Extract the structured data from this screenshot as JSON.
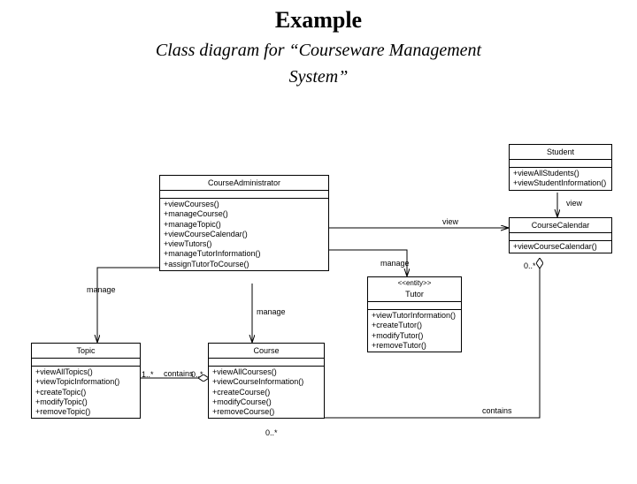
{
  "title": "Example",
  "subtitle_line1": "Class diagram for “Courseware Management",
  "subtitle_line2": "System”",
  "classes": {
    "courseAdmin": {
      "name": "CourseAdministrator",
      "ops": [
        "+viewCourses()",
        "+manageCourse()",
        "+manageTopic()",
        "+viewCourseCalendar()",
        "+viewTutors()",
        "+manageTutorInformation()",
        "+assignTutorToCourse()"
      ]
    },
    "student": {
      "name": "Student",
      "ops": [
        "+viewAllStudents()",
        "+viewStudentInformation()"
      ]
    },
    "courseCalendar": {
      "name": "CourseCalendar",
      "ops": [
        "+viewCourseCalendar()"
      ]
    },
    "tutor": {
      "stereotype": "<<entity>>",
      "name": "Tutor",
      "ops": [
        "+viewTutorInformation()",
        "+createTutor()",
        "+modifyTutor()",
        "+removeTutor()"
      ]
    },
    "topic": {
      "name": "Topic",
      "ops": [
        "+viewAllTopics()",
        "+viewTopicInformation()",
        "+createTopic()",
        "+modifyTopic()",
        "+removeTopic()"
      ]
    },
    "course": {
      "name": "Course",
      "ops": [
        "+viewAllCourses()",
        "+viewCourseInformation()",
        "+createCourse()",
        "+modifyCourse()",
        "+removeCourse()"
      ]
    }
  },
  "labels": {
    "manage1": "manage",
    "manage2": "manage",
    "manage3": "manage",
    "view1": "view",
    "view2": "view",
    "contains1": "contains",
    "contains2": "contains",
    "mult1": "1..*",
    "mult2": "0..*",
    "mult3": "0..*",
    "mult4": "0..*"
  }
}
